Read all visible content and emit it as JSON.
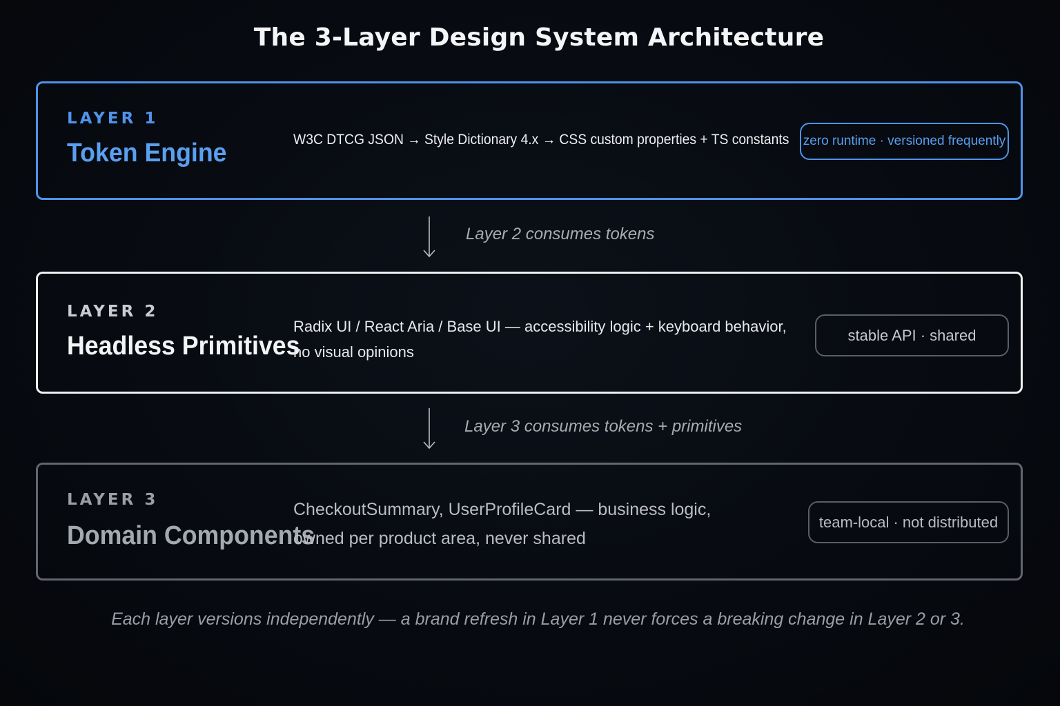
{
  "title": "The 3-Layer Design System Architecture",
  "colors": {
    "accent_blue": "#4f94ea",
    "layer_2_border": "#eef0f3",
    "layer_3_border": "#62666d",
    "background": "#070a10"
  },
  "layers": [
    {
      "kicker": "LAYER 1",
      "name": "Token Engine",
      "description_lines": [
        "W3C DTCG JSON → Style Dictionary 4.x → CSS custom properties + TS constants"
      ],
      "badge": "zero runtime · versioned frequently"
    },
    {
      "kicker": "LAYER 2",
      "name": "Headless Primitives",
      "description_lines": [
        "Radix UI / React Aria / Base UI — accessibility logic + keyboard behavior,",
        "no visual opinions"
      ],
      "badge": "stable API · shared"
    },
    {
      "kicker": "LAYER 3",
      "name": "Domain Components",
      "description_lines": [
        "CheckoutSummary, UserProfileCard — business logic,",
        "owned per product area, never shared"
      ],
      "badge": "team-local · not distributed"
    }
  ],
  "connectors": [
    {
      "icon": "arrow-down-icon",
      "label": "Layer 2 consumes tokens"
    },
    {
      "icon": "arrow-down-icon",
      "label": "Layer 3 consumes tokens + primitives"
    }
  ],
  "footer": "Each layer versions independently — a brand refresh in Layer 1 never forces a breaking change in Layer 2 or 3."
}
